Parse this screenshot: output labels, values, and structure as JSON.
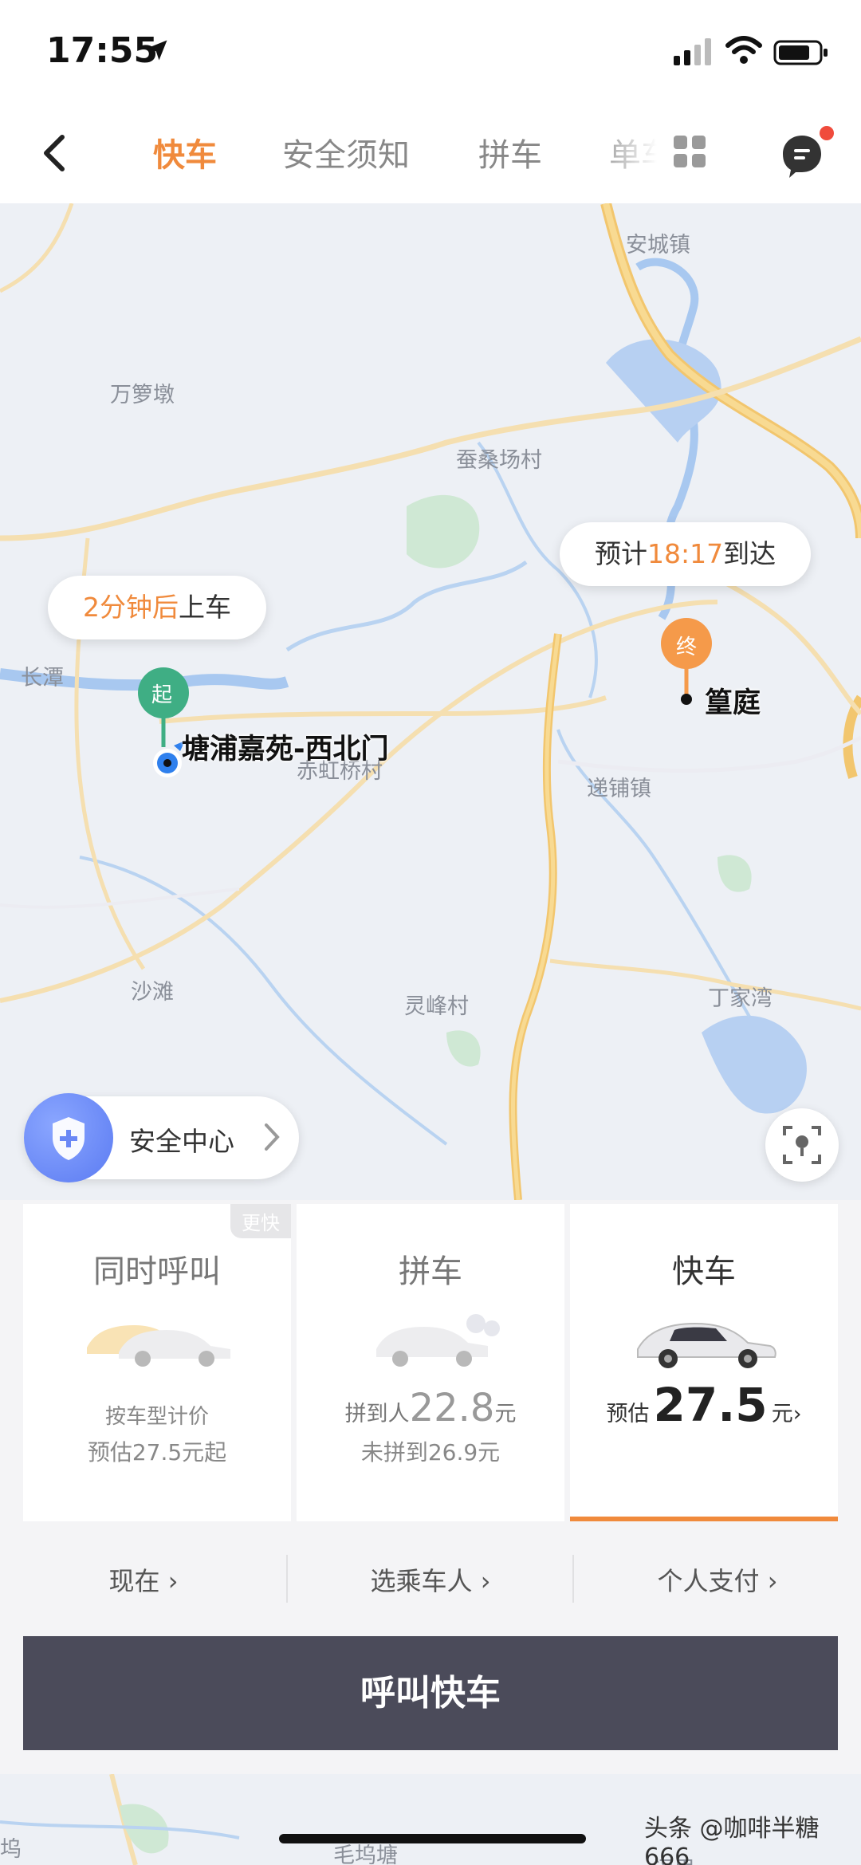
{
  "status_bar": {
    "time": "17:55"
  },
  "nav": {
    "tabs": [
      "快车",
      "安全须知",
      "拼车",
      "单车"
    ],
    "active_tab": "快车"
  },
  "map": {
    "places": [
      {
        "name": "安城镇"
      },
      {
        "name": "万箩墩"
      },
      {
        "name": "蚕桑场村"
      },
      {
        "name": "长潭"
      },
      {
        "name": "赤虹桥村"
      },
      {
        "name": "递铺镇"
      },
      {
        "name": "沙滩"
      },
      {
        "name": "灵峰村"
      },
      {
        "name": "丁家湾"
      }
    ],
    "pickup": {
      "bubble_highlight": "2分钟后",
      "bubble_rest": "上车",
      "marker": "起",
      "label": "塘浦嘉苑-西北门"
    },
    "destination": {
      "bubble_prefix": "预计",
      "bubble_time": "18:17",
      "bubble_suffix": "到达",
      "marker": "终",
      "label": "篁庭"
    },
    "safety_center": "安全中心"
  },
  "cards": [
    {
      "title": "同时呼叫",
      "badge": "更快",
      "line1": "按车型计价",
      "line2": "预估27.5元起"
    },
    {
      "title": "拼车",
      "pool_prefix": "拼到人",
      "pool_price": "22.8",
      "pool_unit": "元",
      "line2": "未拼到26.9元"
    },
    {
      "title": "快车",
      "est_prefix": "预估",
      "price": "27.5",
      "unit": "元",
      "selected": true
    }
  ],
  "options": [
    "现在",
    "选乘车人",
    "个人支付"
  ],
  "call_button": "呼叫快车",
  "bottom_map_places": [
    "坞",
    "毛坞塘",
    "闵里"
  ],
  "watermark": "头条 @咖啡半糖666",
  "colors": {
    "accent": "#f08a3c",
    "pickup_green": "#3fae84",
    "dest_orange": "#f59a4a",
    "call_button_bg": "#4b4b5a"
  }
}
